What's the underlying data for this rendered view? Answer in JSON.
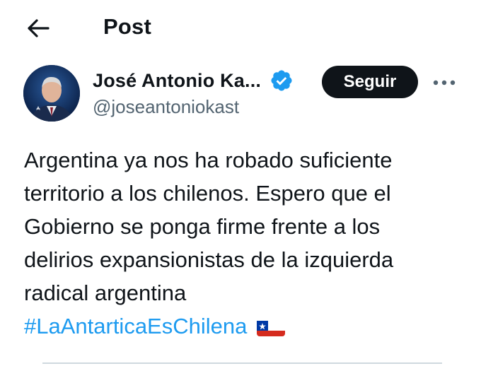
{
  "header": {
    "back_icon": "arrow-left-icon",
    "title": "Post"
  },
  "author": {
    "name": "José Antonio Ka...",
    "handle": "@joseantoniokast",
    "verified_icon": "verified-badge-icon",
    "verified_color": "#1d9bf0"
  },
  "actions": {
    "follow_label": "Seguir",
    "more_icon": "more-options-icon"
  },
  "tweet": {
    "lines": [
      "Argentina ya nos ha robado suficiente",
      "territorio a los chilenos. Espero que el",
      "Gobierno se ponga firme frente a los",
      "delirios expansionistas de la izquierda",
      "radical argentina"
    ],
    "hashtag": "#LaAntarticaEsChilena",
    "hashtag_color": "#1d9bf0",
    "emoji": "chile-flag-icon"
  }
}
